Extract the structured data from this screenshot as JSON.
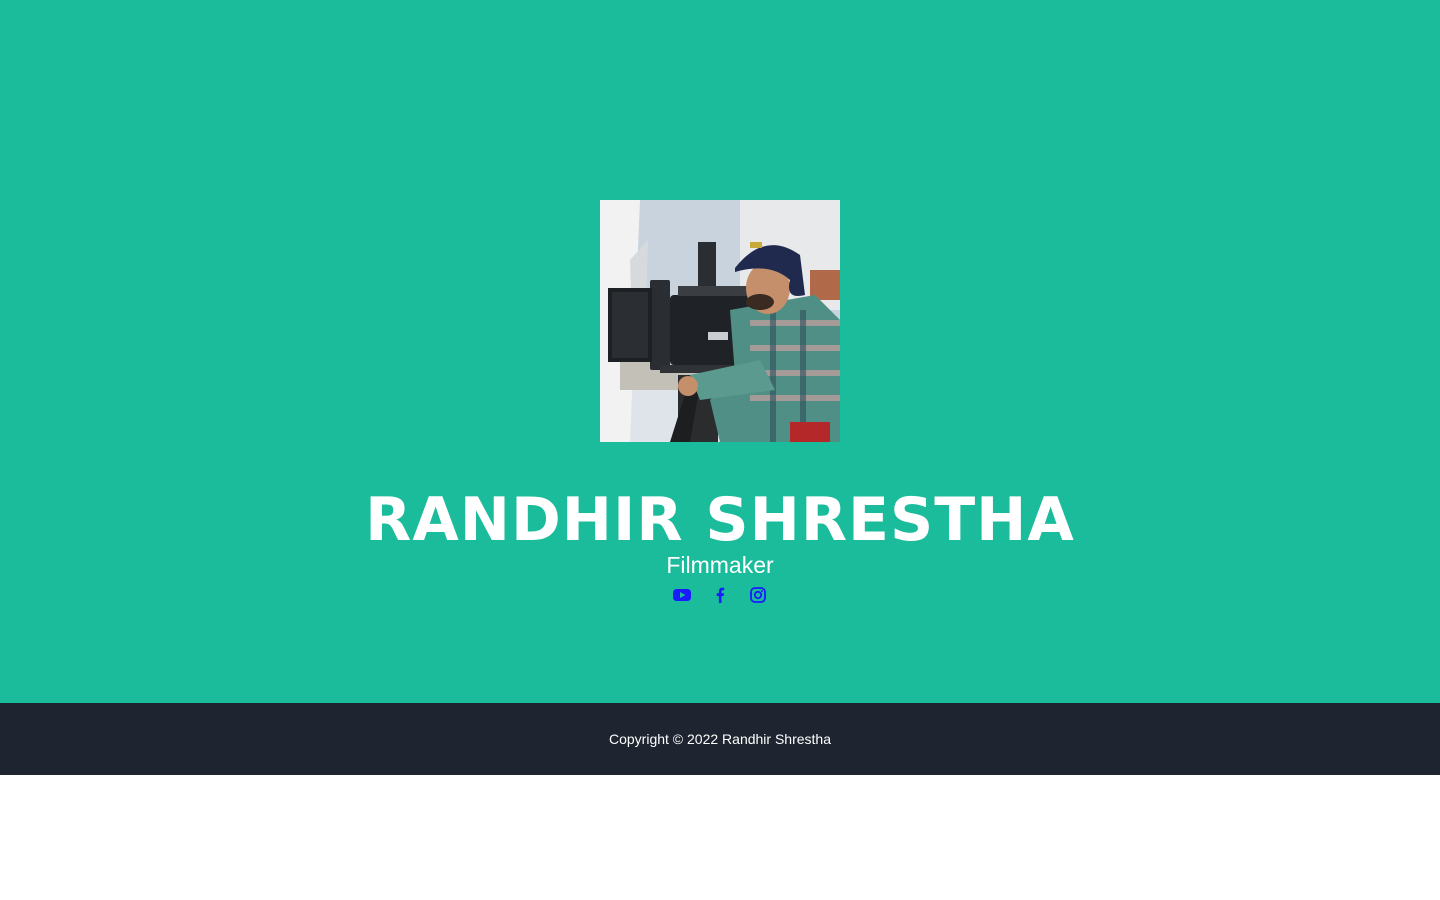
{
  "colors": {
    "masthead_bg": "#1abc9c",
    "footer_bg": "#1e2530",
    "text": "#ffffff",
    "social_icon": "#1a1aff"
  },
  "masthead": {
    "name": "RANDHIR SHRESTHA",
    "subtitle": "Filmmaker",
    "social": [
      {
        "icon": "youtube-icon"
      },
      {
        "icon": "facebook-icon"
      },
      {
        "icon": "instagram-icon"
      }
    ]
  },
  "footer": {
    "copyright": "Copyright © 2022 Randhir Shrestha"
  }
}
